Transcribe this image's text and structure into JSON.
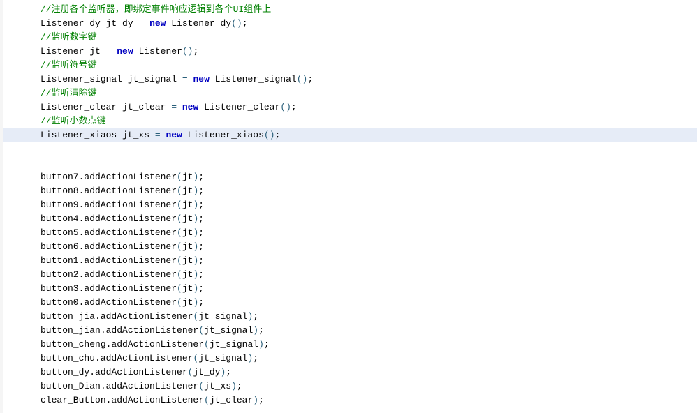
{
  "code": {
    "lines": [
      {
        "hl": false,
        "segs": [
          {
            "t": "//注册各个监听器，即绑定事件响应逻辑到各个UI组件上",
            "c": "comment"
          }
        ]
      },
      {
        "hl": false,
        "segs": [
          {
            "t": "Listener_dy jt_dy ",
            "c": "ident"
          },
          {
            "t": "=",
            "c": "paren"
          },
          {
            "t": " ",
            "c": "ident"
          },
          {
            "t": "new",
            "c": "keyword"
          },
          {
            "t": " Listener_dy",
            "c": "ident"
          },
          {
            "t": "()",
            "c": "paren"
          },
          {
            "t": ";",
            "c": "semi"
          }
        ]
      },
      {
        "hl": false,
        "segs": [
          {
            "t": "//监听数字键",
            "c": "comment"
          }
        ]
      },
      {
        "hl": false,
        "segs": [
          {
            "t": "Listener jt ",
            "c": "ident"
          },
          {
            "t": "=",
            "c": "paren"
          },
          {
            "t": " ",
            "c": "ident"
          },
          {
            "t": "new",
            "c": "keyword"
          },
          {
            "t": " Listener",
            "c": "ident"
          },
          {
            "t": "()",
            "c": "paren"
          },
          {
            "t": ";",
            "c": "semi"
          }
        ]
      },
      {
        "hl": false,
        "segs": [
          {
            "t": "//监听符号键",
            "c": "comment"
          }
        ]
      },
      {
        "hl": false,
        "segs": [
          {
            "t": "Listener_signal jt_signal ",
            "c": "ident"
          },
          {
            "t": "=",
            "c": "paren"
          },
          {
            "t": " ",
            "c": "ident"
          },
          {
            "t": "new",
            "c": "keyword"
          },
          {
            "t": " Listener_signal",
            "c": "ident"
          },
          {
            "t": "()",
            "c": "paren"
          },
          {
            "t": ";",
            "c": "semi"
          }
        ]
      },
      {
        "hl": false,
        "segs": [
          {
            "t": "//监听清除键",
            "c": "comment"
          }
        ]
      },
      {
        "hl": false,
        "segs": [
          {
            "t": "Listener_clear jt_clear ",
            "c": "ident"
          },
          {
            "t": "=",
            "c": "paren"
          },
          {
            "t": " ",
            "c": "ident"
          },
          {
            "t": "new",
            "c": "keyword"
          },
          {
            "t": " Listener_clear",
            "c": "ident"
          },
          {
            "t": "()",
            "c": "paren"
          },
          {
            "t": ";",
            "c": "semi"
          }
        ]
      },
      {
        "hl": false,
        "segs": [
          {
            "t": "//监听小数点键",
            "c": "comment"
          }
        ]
      },
      {
        "hl": true,
        "segs": [
          {
            "t": "Listener_xiaos jt_xs ",
            "c": "ident"
          },
          {
            "t": "=",
            "c": "paren"
          },
          {
            "t": " ",
            "c": "ident"
          },
          {
            "t": "new",
            "c": "keyword"
          },
          {
            "t": " Listener_xiaos",
            "c": "ident"
          },
          {
            "t": "()",
            "c": "paren"
          },
          {
            "t": ";",
            "c": "semi"
          }
        ]
      },
      {
        "blank": true
      },
      {
        "hl": false,
        "segs": [
          {
            "t": "button7.addActionListener",
            "c": "ident"
          },
          {
            "t": "(",
            "c": "paren"
          },
          {
            "t": "jt",
            "c": "ident"
          },
          {
            "t": ")",
            "c": "paren"
          },
          {
            "t": ";",
            "c": "semi"
          }
        ]
      },
      {
        "hl": false,
        "segs": [
          {
            "t": "button8.addActionListener",
            "c": "ident"
          },
          {
            "t": "(",
            "c": "paren"
          },
          {
            "t": "jt",
            "c": "ident"
          },
          {
            "t": ")",
            "c": "paren"
          },
          {
            "t": ";",
            "c": "semi"
          }
        ]
      },
      {
        "hl": false,
        "segs": [
          {
            "t": "button9.addActionListener",
            "c": "ident"
          },
          {
            "t": "(",
            "c": "paren"
          },
          {
            "t": "jt",
            "c": "ident"
          },
          {
            "t": ")",
            "c": "paren"
          },
          {
            "t": ";",
            "c": "semi"
          }
        ]
      },
      {
        "hl": false,
        "segs": [
          {
            "t": "button4.addActionListener",
            "c": "ident"
          },
          {
            "t": "(",
            "c": "paren"
          },
          {
            "t": "jt",
            "c": "ident"
          },
          {
            "t": ")",
            "c": "paren"
          },
          {
            "t": ";",
            "c": "semi"
          }
        ]
      },
      {
        "hl": false,
        "segs": [
          {
            "t": "button5.addActionListener",
            "c": "ident"
          },
          {
            "t": "(",
            "c": "paren"
          },
          {
            "t": "jt",
            "c": "ident"
          },
          {
            "t": ")",
            "c": "paren"
          },
          {
            "t": ";",
            "c": "semi"
          }
        ]
      },
      {
        "hl": false,
        "segs": [
          {
            "t": "button6.addActionListener",
            "c": "ident"
          },
          {
            "t": "(",
            "c": "paren"
          },
          {
            "t": "jt",
            "c": "ident"
          },
          {
            "t": ")",
            "c": "paren"
          },
          {
            "t": ";",
            "c": "semi"
          }
        ]
      },
      {
        "hl": false,
        "segs": [
          {
            "t": "button1.addActionListener",
            "c": "ident"
          },
          {
            "t": "(",
            "c": "paren"
          },
          {
            "t": "jt",
            "c": "ident"
          },
          {
            "t": ")",
            "c": "paren"
          },
          {
            "t": ";",
            "c": "semi"
          }
        ]
      },
      {
        "hl": false,
        "segs": [
          {
            "t": "button2.addActionListener",
            "c": "ident"
          },
          {
            "t": "(",
            "c": "paren"
          },
          {
            "t": "jt",
            "c": "ident"
          },
          {
            "t": ")",
            "c": "paren"
          },
          {
            "t": ";",
            "c": "semi"
          }
        ]
      },
      {
        "hl": false,
        "segs": [
          {
            "t": "button3.addActionListener",
            "c": "ident"
          },
          {
            "t": "(",
            "c": "paren"
          },
          {
            "t": "jt",
            "c": "ident"
          },
          {
            "t": ")",
            "c": "paren"
          },
          {
            "t": ";",
            "c": "semi"
          }
        ]
      },
      {
        "hl": false,
        "segs": [
          {
            "t": "button0.addActionListener",
            "c": "ident"
          },
          {
            "t": "(",
            "c": "paren"
          },
          {
            "t": "jt",
            "c": "ident"
          },
          {
            "t": ")",
            "c": "paren"
          },
          {
            "t": ";",
            "c": "semi"
          }
        ]
      },
      {
        "hl": false,
        "segs": [
          {
            "t": "button_jia.addActionListener",
            "c": "ident"
          },
          {
            "t": "(",
            "c": "paren"
          },
          {
            "t": "jt_signal",
            "c": "ident"
          },
          {
            "t": ")",
            "c": "paren"
          },
          {
            "t": ";",
            "c": "semi"
          }
        ]
      },
      {
        "hl": false,
        "segs": [
          {
            "t": "button_jian.addActionListener",
            "c": "ident"
          },
          {
            "t": "(",
            "c": "paren"
          },
          {
            "t": "jt_signal",
            "c": "ident"
          },
          {
            "t": ")",
            "c": "paren"
          },
          {
            "t": ";",
            "c": "semi"
          }
        ]
      },
      {
        "hl": false,
        "segs": [
          {
            "t": "button_cheng.addActionListener",
            "c": "ident"
          },
          {
            "t": "(",
            "c": "paren"
          },
          {
            "t": "jt_signal",
            "c": "ident"
          },
          {
            "t": ")",
            "c": "paren"
          },
          {
            "t": ";",
            "c": "semi"
          }
        ]
      },
      {
        "hl": false,
        "segs": [
          {
            "t": "button_chu.addActionListener",
            "c": "ident"
          },
          {
            "t": "(",
            "c": "paren"
          },
          {
            "t": "jt_signal",
            "c": "ident"
          },
          {
            "t": ")",
            "c": "paren"
          },
          {
            "t": ";",
            "c": "semi"
          }
        ]
      },
      {
        "hl": false,
        "segs": [
          {
            "t": "button_dy.addActionListener",
            "c": "ident"
          },
          {
            "t": "(",
            "c": "paren"
          },
          {
            "t": "jt_dy",
            "c": "ident"
          },
          {
            "t": ")",
            "c": "paren"
          },
          {
            "t": ";",
            "c": "semi"
          }
        ]
      },
      {
        "hl": false,
        "segs": [
          {
            "t": "button_Dian.addActionListener",
            "c": "ident"
          },
          {
            "t": "(",
            "c": "paren"
          },
          {
            "t": "jt_xs",
            "c": "ident"
          },
          {
            "t": ")",
            "c": "paren"
          },
          {
            "t": ";",
            "c": "semi"
          }
        ]
      },
      {
        "hl": false,
        "segs": [
          {
            "t": "clear_Button.addActionListener",
            "c": "ident"
          },
          {
            "t": "(",
            "c": "paren"
          },
          {
            "t": "jt_clear",
            "c": "ident"
          },
          {
            "t": ")",
            "c": "paren"
          },
          {
            "t": ";",
            "c": "semi"
          }
        ]
      }
    ]
  }
}
